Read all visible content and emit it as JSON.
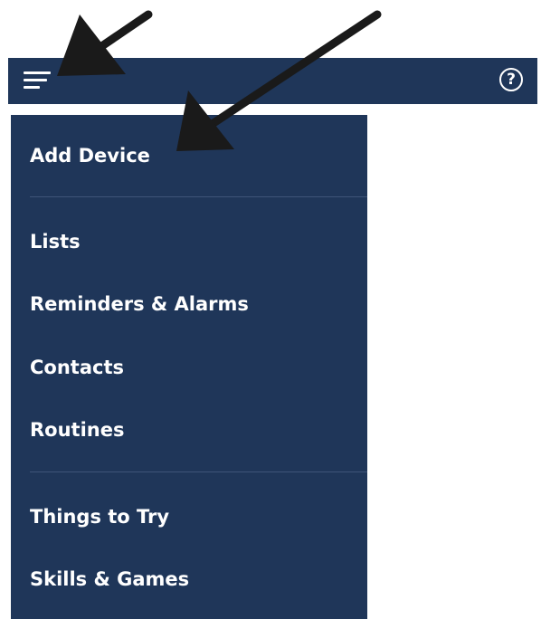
{
  "header": {
    "menu_icon": "hamburger-menu-icon",
    "help_icon": "help-circle-icon",
    "help_glyph": "?"
  },
  "menu": {
    "items": [
      {
        "label": "Add Device"
      },
      {
        "label": "Lists"
      },
      {
        "label": "Reminders & Alarms"
      },
      {
        "label": "Contacts"
      },
      {
        "label": "Routines"
      },
      {
        "label": "Things to Try"
      },
      {
        "label": "Skills & Games"
      }
    ]
  },
  "colors": {
    "bar_background": "#1f3659",
    "menu_text": "#ffffff",
    "annotation_arrow": "#1a1a1a"
  }
}
